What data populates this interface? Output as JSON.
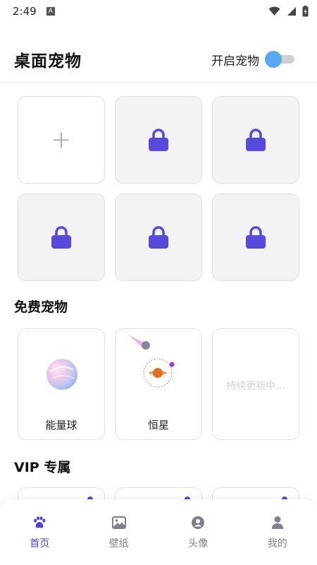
{
  "status_bar": {
    "time": "2:49",
    "notification_icon": "a-icon"
  },
  "header": {
    "title": "桌面宠物",
    "toggle_label": "开启宠物",
    "toggle_on": true
  },
  "colors": {
    "accent": "#4f44d8",
    "lock": "#5848dc",
    "toggle_thumb": "#5aa7f4",
    "inactive": "#7d7f8c"
  },
  "slots": [
    {
      "type": "add",
      "icon": "plus-icon"
    },
    {
      "type": "locked",
      "icon": "lock-icon"
    },
    {
      "type": "locked",
      "icon": "lock-icon"
    },
    {
      "type": "locked",
      "icon": "lock-icon"
    },
    {
      "type": "locked",
      "icon": "lock-icon"
    },
    {
      "type": "locked",
      "icon": "lock-icon"
    }
  ],
  "free_section": {
    "title": "免费宠物",
    "pets": [
      {
        "name": "能量球",
        "icon": "energy-ball-icon"
      },
      {
        "name": "恒星",
        "icon": "star-planet-icon"
      }
    ],
    "coming_soon": "持续更新中..."
  },
  "vip_section": {
    "title": "VIP 专属"
  },
  "tabbar": {
    "items": [
      {
        "label": "首页",
        "icon": "paw-icon",
        "active": true
      },
      {
        "label": "壁纸",
        "icon": "image-icon",
        "active": false
      },
      {
        "label": "头像",
        "icon": "avatar-circle-icon",
        "active": false
      },
      {
        "label": "我的",
        "icon": "person-icon",
        "active": false
      }
    ]
  }
}
